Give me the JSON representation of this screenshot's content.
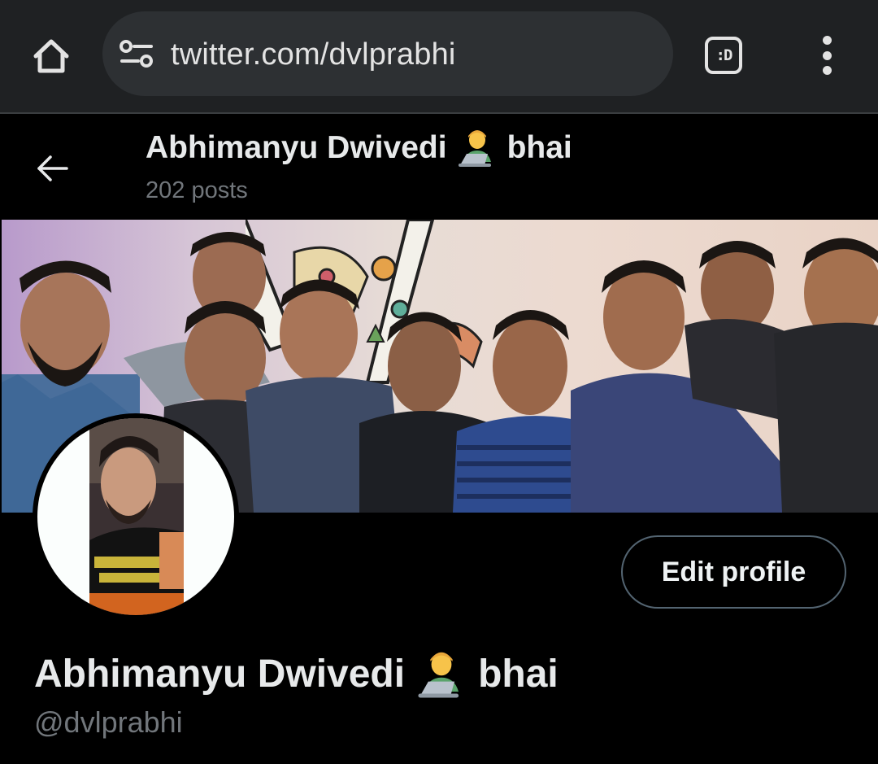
{
  "browser": {
    "url": "twitter.com/dvlprabhi",
    "extension_label": ":D",
    "icons": {
      "home": "home-icon",
      "site_info": "tune-icon",
      "menu": "more-vertical-icon"
    }
  },
  "header": {
    "display_name": "Abhimanyu Dwivedi",
    "name_suffix": "bhai",
    "posts_count": "202 posts",
    "emoji": "technologist-emoji"
  },
  "profile": {
    "display_name": "Abhimanyu Dwivedi",
    "name_suffix": "bhai",
    "handle": "@dvlprabhi",
    "edit_button": "Edit profile"
  },
  "colors": {
    "background": "#000000",
    "chrome": "#1f2123",
    "urlbar": "#2d3033",
    "text_primary": "#e7e9ea",
    "text_secondary": "#71767b",
    "button_border": "#536471"
  }
}
